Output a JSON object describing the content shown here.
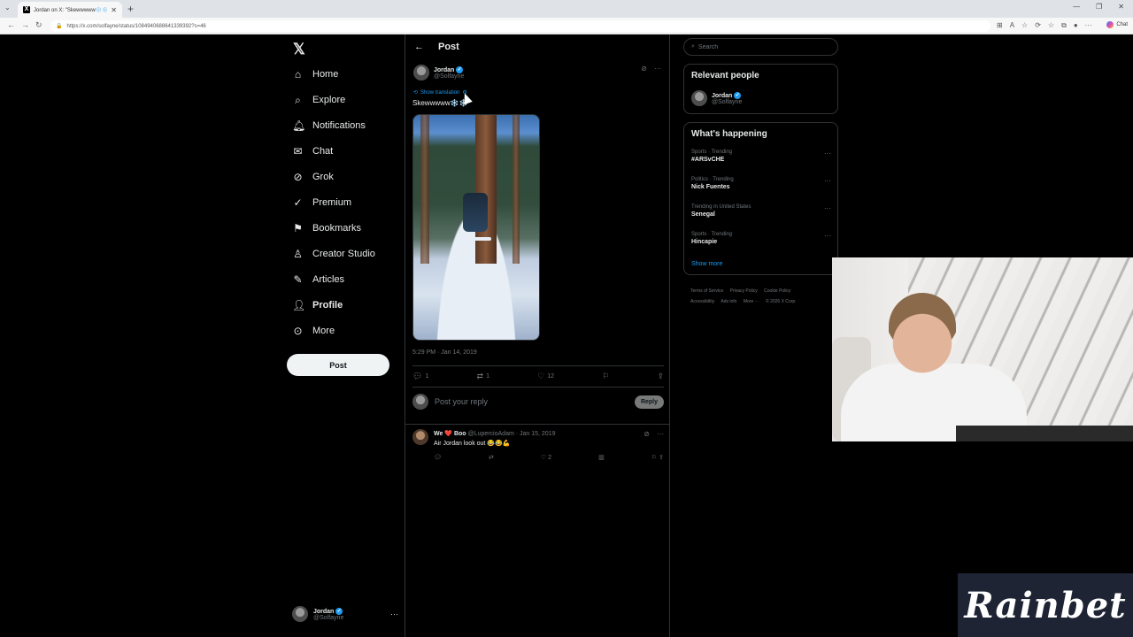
{
  "browser": {
    "tab_title": "Jordan on X: \"Skewwwww❄️❄️\" / X",
    "tab_icon": "x-logo-icon",
    "url": "https://x.com/solfayne/status/1084940688641339392?s=46",
    "copilot_label": "Chat"
  },
  "nav": {
    "items": [
      {
        "label": "Home",
        "icon": "home-icon"
      },
      {
        "label": "Explore",
        "icon": "search-icon"
      },
      {
        "label": "Notifications",
        "icon": "bell-icon"
      },
      {
        "label": "Chat",
        "icon": "mail-icon"
      },
      {
        "label": "Grok",
        "icon": "grok-icon"
      },
      {
        "label": "Premium",
        "icon": "premium-icon"
      },
      {
        "label": "Bookmarks",
        "icon": "bookmark-icon"
      },
      {
        "label": "Creator Studio",
        "icon": "creator-icon"
      },
      {
        "label": "Articles",
        "icon": "articles-icon"
      },
      {
        "label": "Profile",
        "icon": "profile-icon"
      },
      {
        "label": "More",
        "icon": "more-icon"
      }
    ],
    "post_button": "Post",
    "account": {
      "name": "Jordan",
      "handle": "@Solfayne"
    }
  },
  "main": {
    "title": "Post",
    "post": {
      "author_name": "Jordan",
      "author_handle": "@Solfayne",
      "translation": "Show translation",
      "text": "Skewwwww❄️❄️",
      "timestamp": "5:29 PM · Jan 14, 2019",
      "replies": "1",
      "reposts": "1",
      "likes": "12"
    },
    "reply_placeholder": "Post your reply",
    "reply_button": "Reply",
    "replies": [
      {
        "name": "We ❤️ Boo",
        "meta": "@LupercioAdam · Jan 15, 2019",
        "text": "Air Jordan look out 😂😂💪",
        "likes": "2"
      }
    ]
  },
  "sidebar": {
    "search_placeholder": "Search",
    "relevant_title": "Relevant people",
    "relevant_person": {
      "name": "Jordan",
      "handle": "@Solfayne"
    },
    "happening_title": "What's happening",
    "trends": [
      {
        "category": "Sports · Trending",
        "title": "#ARSvCHE"
      },
      {
        "category": "Politics · Trending",
        "title": "Nick Fuentes"
      },
      {
        "category": "Trending in United States",
        "title": "Senegal"
      },
      {
        "category": "Sports · Trending",
        "title": "Hincapie"
      }
    ],
    "show_more": "Show more",
    "footer": [
      "Terms of Service",
      "Privacy Policy",
      "Cookie Policy",
      "Accessibility",
      "Ads info",
      "More ···",
      "© 2026 X Corp."
    ]
  },
  "overlay": {
    "sponsor": "Rainbet"
  },
  "colors": {
    "accent": "#1d9bf0",
    "background": "#000000",
    "muted": "#71767b",
    "like": "#f91880"
  }
}
